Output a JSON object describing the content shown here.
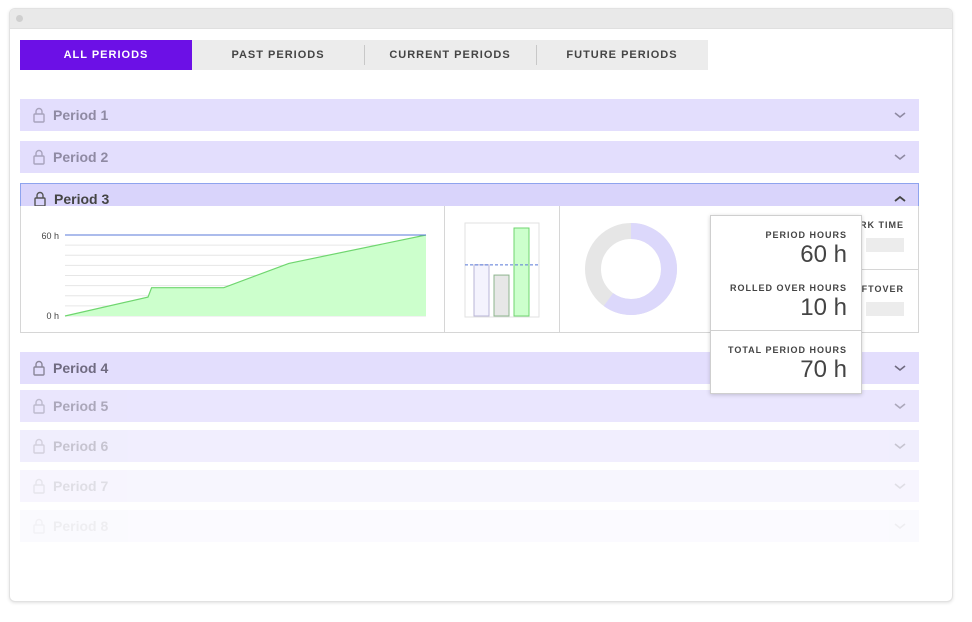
{
  "tabs": [
    {
      "label": "ALL PERIODS",
      "active": true
    },
    {
      "label": "PAST PERIODS",
      "active": false
    },
    {
      "label": "CURRENT PERIODS",
      "active": false
    },
    {
      "label": "FUTURE PERIODS",
      "active": false
    }
  ],
  "periods": [
    {
      "label": "Period 1",
      "state": "collapsed"
    },
    {
      "label": "Period 2",
      "state": "collapsed"
    },
    {
      "label": "Period 3",
      "state": "expanded"
    },
    {
      "label": "Period 4",
      "state": "collapsed"
    },
    {
      "label": "Period 5",
      "state": "collapsed"
    },
    {
      "label": "Period 6",
      "state": "collapsed"
    },
    {
      "label": "Period 7",
      "state": "collapsed"
    },
    {
      "label": "Period 8",
      "state": "collapsed"
    }
  ],
  "expanded": {
    "line_chart": {
      "y_ticks": [
        "60 h",
        "0 h"
      ],
      "target": 60,
      "ymax": 60,
      "points": [
        [
          0,
          0
        ],
        [
          0.23,
          14
        ],
        [
          0.24,
          21
        ],
        [
          0.44,
          21
        ],
        [
          0.62,
          39
        ],
        [
          1,
          60
        ]
      ]
    },
    "bar_chart": {
      "values": [
        50,
        40,
        86
      ],
      "reference": 50,
      "max": 86
    },
    "donut": {
      "filled_fraction": 0.6
    },
    "side_labels": {
      "work_time": "ORK TIME",
      "leftover": "LEFTOVER"
    }
  },
  "tooltip": {
    "period_hours_label": "PERIOD HOURS",
    "period_hours_value": "60 h",
    "rolled_over_label": "ROLLED OVER HOURS",
    "rolled_over_value": "10 h",
    "total_label": "TOTAL PERIOD HOURS",
    "total_value": "70 h"
  },
  "colors": {
    "accent": "#6c10e6",
    "row_bg": "#e3defd",
    "row_open_bg": "#d9d4fb",
    "chart_fill": "#ccffcc",
    "chart_stroke": "#6fd66f",
    "target_line": "#5878d8",
    "donut_fill": "#dcd8fb",
    "donut_rest": "#e6e6e6"
  },
  "icons": {
    "lock": "lock-icon",
    "chevron_down": "chevron-down-icon",
    "chevron_up": "chevron-up-icon"
  }
}
